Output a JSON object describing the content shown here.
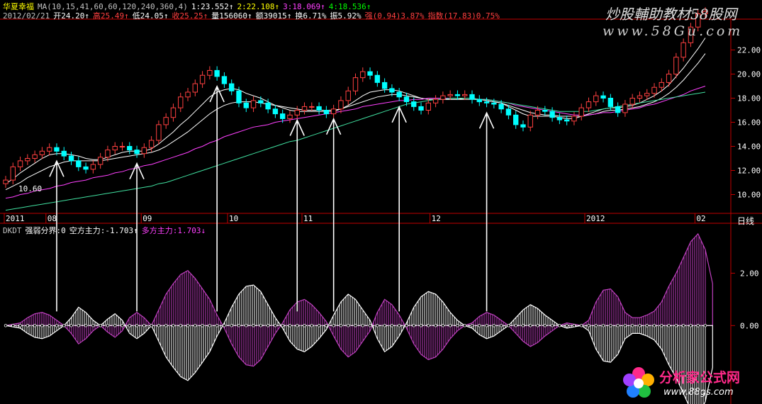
{
  "stock": {
    "name": "华夏幸福"
  },
  "ma_header": {
    "label": "MA(10,15,41,60,60,120,240,360,4)",
    "items": [
      {
        "label": "1:23.552↑",
        "color": "#ffffff"
      },
      {
        "label": "2:22.108↑",
        "color": "#ffff00"
      },
      {
        "label": "3:18.069↑",
        "color": "#ff40ff"
      },
      {
        "label": "4:18.536↑",
        "color": "#00ff00"
      }
    ]
  },
  "quote": {
    "date": "2012/02/21",
    "items": [
      {
        "label": "开24.20↑",
        "color": "#ffffff"
      },
      {
        "label": "高25.49↑",
        "color": "#ff4040"
      },
      {
        "label": "低24.05↑",
        "color": "#ffffff"
      },
      {
        "label": "收25.25↑",
        "color": "#ff4040"
      },
      {
        "label": "量156060↑",
        "color": "#ffffff"
      },
      {
        "label": "额39015↑",
        "color": "#ffffff"
      },
      {
        "label": "换6.71%",
        "color": "#ffffff"
      },
      {
        "label": "振5.92%",
        "color": "#ffffff"
      },
      {
        "label": "强(0.94)3.87%",
        "color": "#ff4040"
      },
      {
        "label": "指数(17.83)0.75%",
        "color": "#ff4040"
      }
    ]
  },
  "indicator_header": {
    "name": "DKDT",
    "items": [
      {
        "label": "强弱分界:0",
        "color": "#ffffff"
      },
      {
        "label": "空方主力:-1.703↑",
        "color": "#ffffff"
      },
      {
        "label": "多方主力:1.703↓",
        "color": "#ff40ff"
      }
    ]
  },
  "watermark": {
    "top_text": "炒股輔助教材58股网",
    "top_url": "www.58Gu.com",
    "bottom_text": "分析家公式网",
    "bottom_url": "www.88gs.com"
  },
  "annotations": {
    "low_price_label": "10.60"
  },
  "period_label": "日线",
  "colors": {
    "up": "#ff4040",
    "down": "#00ffff",
    "ma_fast": "#ffffff",
    "ma_mid": "#ff40ff",
    "ma_slow": "#40e0a0",
    "axis": "#c00000",
    "bull": "#c040c0",
    "bear": "#ffffff"
  },
  "chart_data": [
    {
      "type": "candlestick",
      "title": "",
      "y_ticks": [
        10.0,
        12.0,
        14.0,
        16.0,
        18.0,
        20.0,
        22.0
      ],
      "y_tick_labels": [
        "10.00",
        "12.00",
        "14.00",
        "16.00",
        "18.00",
        "20.00",
        "22.00"
      ],
      "ylim": [
        8.5,
        24.5
      ],
      "x_labels": [
        "2011",
        "08",
        "09",
        "10",
        "11",
        "12",
        "2012",
        "02"
      ],
      "close": [
        11.2,
        12.3,
        12.8,
        13.0,
        13.3,
        13.6,
        13.9,
        13.6,
        13.2,
        12.8,
        12.3,
        12.1,
        12.5,
        13.1,
        13.7,
        14.0,
        14.0,
        13.7,
        13.4,
        13.9,
        14.5,
        15.8,
        16.4,
        17.2,
        18.1,
        18.5,
        19.2,
        19.9,
        20.3,
        19.8,
        19.2,
        18.6,
        17.6,
        17.2,
        17.8,
        17.6,
        17.1,
        16.7,
        16.3,
        16.6,
        17.0,
        17.3,
        17.3,
        17.0,
        16.7,
        17.1,
        17.8,
        18.6,
        19.7,
        20.2,
        19.9,
        19.3,
        18.8,
        18.5,
        18.1,
        17.7,
        17.3,
        17.0,
        17.6,
        17.9,
        18.2,
        18.3,
        18.2,
        18.3,
        17.9,
        17.7,
        17.6,
        17.5,
        17.1,
        16.6,
        15.8,
        15.6,
        16.6,
        17.0,
        16.9,
        16.4,
        16.2,
        16.1,
        16.5,
        17.2,
        17.7,
        18.2,
        18.0,
        17.3,
        16.8,
        17.5,
        18.0,
        18.2,
        18.4,
        18.9,
        19.3,
        20.0,
        21.4,
        22.6,
        23.9,
        25.0,
        25.2
      ],
      "series": [
        {
          "name": "",
          "values": [
            10.9,
            11.3,
            11.8,
            12.2,
            12.6,
            13.0,
            13.3,
            13.4,
            13.4,
            13.3,
            13.2,
            13.0,
            12.9,
            12.9,
            13.1,
            13.3,
            13.5,
            13.6,
            13.6,
            13.6,
            13.8,
            14.2,
            14.7,
            15.2,
            15.8,
            16.3,
            16.9,
            17.5,
            18.1,
            18.5,
            18.7,
            18.8,
            18.7,
            18.4,
            18.2,
            18.0,
            17.7,
            17.4,
            17.2,
            17.0,
            16.9,
            16.9,
            16.9,
            16.9,
            16.9,
            16.9,
            17.1,
            17.4,
            17.8,
            18.2,
            18.5,
            18.6,
            18.7,
            18.7,
            18.6,
            18.4,
            18.2,
            18.0,
            17.9,
            17.9,
            17.9,
            17.9,
            17.9,
            18.0,
            18.0,
            17.9,
            17.8,
            17.7,
            17.6,
            17.3,
            17.0,
            16.7,
            16.5,
            16.5,
            16.5,
            16.5,
            16.4,
            16.3,
            16.3,
            16.5,
            16.7,
            16.9,
            17.1,
            17.2,
            17.2,
            17.3,
            17.4,
            17.6,
            17.9,
            18.2,
            18.6,
            19.1,
            19.8,
            20.5,
            21.3,
            22.1,
            23.0
          ]
        },
        {
          "name": "",
          "values": [
            10.4,
            10.7,
            11.0,
            11.4,
            11.7,
            12.0,
            12.3,
            12.5,
            12.7,
            12.8,
            12.8,
            12.8,
            12.8,
            12.8,
            12.9,
            13.0,
            13.1,
            13.2,
            13.3,
            13.4,
            13.5,
            13.7,
            14.0,
            14.4,
            14.8,
            15.2,
            15.7,
            16.2,
            16.7,
            17.1,
            17.4,
            17.6,
            17.7,
            17.7,
            17.7,
            17.6,
            17.5,
            17.4,
            17.3,
            17.2,
            17.1,
            17.0,
            17.0,
            17.0,
            17.0,
            17.0,
            17.1,
            17.3,
            17.5,
            17.7,
            17.9,
            18.1,
            18.2,
            18.3,
            18.3,
            18.2,
            18.1,
            18.0,
            17.9,
            17.9,
            17.9,
            17.9,
            17.9,
            17.9,
            17.9,
            17.9,
            17.8,
            17.7,
            17.6,
            17.4,
            17.2,
            17.0,
            16.8,
            16.7,
            16.6,
            16.6,
            16.5,
            16.5,
            16.5,
            16.5,
            16.6,
            16.7,
            16.9,
            17.0,
            17.0,
            17.1,
            17.2,
            17.3,
            17.5,
            17.7,
            18.0,
            18.4,
            18.9,
            19.5,
            20.2,
            20.9,
            21.7
          ]
        },
        {
          "name": "",
          "values": [
            9.7,
            9.8,
            10.0,
            10.1,
            10.3,
            10.4,
            10.5,
            10.7,
            10.8,
            11.0,
            11.1,
            11.2,
            11.4,
            11.5,
            11.6,
            11.8,
            11.9,
            12.1,
            12.2,
            12.4,
            12.5,
            12.7,
            12.9,
            13.1,
            13.3,
            13.5,
            13.8,
            14.0,
            14.3,
            14.5,
            14.8,
            15.0,
            15.2,
            15.4,
            15.6,
            15.7,
            15.8,
            16.0,
            16.1,
            16.2,
            16.3,
            16.4,
            16.5,
            16.6,
            16.7,
            16.8,
            16.9,
            17.0,
            17.1,
            17.3,
            17.4,
            17.5,
            17.6,
            17.7,
            17.8,
            17.8,
            17.9,
            17.9,
            18.0,
            18.0,
            18.0,
            18.0,
            18.0,
            18.0,
            18.0,
            17.9,
            17.9,
            17.8,
            17.7,
            17.6,
            17.4,
            17.3,
            17.2,
            17.1,
            17.0,
            16.9,
            16.8,
            16.7,
            16.6,
            16.6,
            16.6,
            16.7,
            16.8,
            16.8,
            16.9,
            17.0,
            17.1,
            17.2,
            17.4,
            17.5,
            17.7,
            17.9,
            18.1,
            18.3,
            18.6,
            18.8,
            19.0
          ]
        },
        {
          "name": "",
          "values": [
            8.7,
            8.8,
            8.9,
            9.0,
            9.1,
            9.2,
            9.3,
            9.4,
            9.5,
            9.6,
            9.7,
            9.8,
            9.9,
            10.0,
            10.1,
            10.2,
            10.3,
            10.4,
            10.5,
            10.6,
            10.7,
            10.9,
            11.0,
            11.2,
            11.4,
            11.6,
            11.8,
            12.0,
            12.2,
            12.4,
            12.6,
            12.8,
            13.0,
            13.2,
            13.4,
            13.6,
            13.8,
            14.0,
            14.2,
            14.4,
            14.5,
            14.7,
            14.9,
            15.1,
            15.3,
            15.5,
            15.7,
            15.9,
            16.1,
            16.3,
            16.5,
            16.7,
            16.9,
            17.1,
            17.3,
            17.5,
            17.6,
            17.7,
            17.8,
            17.9,
            17.9,
            18.0,
            18.0,
            18.0,
            18.0,
            17.9,
            17.9,
            17.8,
            17.7,
            17.6,
            17.5,
            17.4,
            17.3,
            17.2,
            17.1,
            17.0,
            16.9,
            16.9,
            16.9,
            16.9,
            16.9,
            17.0,
            17.1,
            17.2,
            17.3,
            17.4,
            17.5,
            17.6,
            17.7,
            17.8,
            17.9,
            18.0,
            18.1,
            18.2,
            18.3,
            18.4,
            18.5
          ]
        }
      ]
    },
    {
      "type": "area",
      "title": "DKDT",
      "y_ticks": [
        0.0,
        2.0
      ],
      "y_tick_labels": [
        "0.00",
        "2.00"
      ],
      "ylim": [
        -2.4,
        3.5
      ],
      "series": [
        {
          "name": "多方主力",
          "values": [
            0.0,
            0.05,
            0.1,
            0.3,
            0.45,
            0.5,
            0.4,
            0.2,
            0.0,
            -0.3,
            -0.7,
            -0.5,
            -0.2,
            0.0,
            -0.25,
            -0.45,
            -0.2,
            0.3,
            0.5,
            0.3,
            0.0,
            0.6,
            1.2,
            1.6,
            1.95,
            2.1,
            1.8,
            1.4,
            1.0,
            0.4,
            -0.1,
            -0.7,
            -1.2,
            -1.5,
            -1.55,
            -1.3,
            -0.8,
            -0.3,
            0.1,
            0.6,
            0.9,
            1.0,
            0.8,
            0.5,
            0.15,
            -0.4,
            -0.9,
            -1.2,
            -1.0,
            -0.6,
            -0.2,
            0.5,
            1.0,
            0.8,
            0.4,
            -0.1,
            -0.7,
            -1.1,
            -1.3,
            -1.2,
            -0.9,
            -0.5,
            -0.2,
            0.0,
            0.1,
            0.35,
            0.5,
            0.4,
            0.2,
            0.0,
            -0.3,
            -0.6,
            -0.8,
            -0.65,
            -0.4,
            -0.2,
            0.0,
            0.1,
            0.05,
            0.0,
            0.2,
            0.9,
            1.35,
            1.4,
            1.1,
            0.5,
            0.3,
            0.3,
            0.4,
            0.55,
            0.9,
            1.5,
            2.0,
            2.6,
            3.2,
            3.5,
            2.9,
            1.6
          ]
        },
        {
          "name": "空方主力",
          "values": [
            0.0,
            -0.05,
            -0.1,
            -0.3,
            -0.45,
            -0.5,
            -0.4,
            -0.2,
            0.0,
            0.3,
            0.7,
            0.5,
            0.2,
            0.0,
            0.25,
            0.45,
            0.2,
            -0.3,
            -0.5,
            -0.3,
            0.0,
            -0.6,
            -1.2,
            -1.6,
            -1.95,
            -2.1,
            -1.8,
            -1.4,
            -1.0,
            -0.4,
            0.1,
            0.7,
            1.2,
            1.5,
            1.55,
            1.3,
            0.8,
            0.3,
            -0.1,
            -0.6,
            -0.9,
            -1.0,
            -0.8,
            -0.5,
            -0.15,
            0.4,
            0.9,
            1.2,
            1.0,
            0.6,
            0.2,
            -0.5,
            -1.0,
            -0.8,
            -0.4,
            0.1,
            0.7,
            1.1,
            1.3,
            1.2,
            0.9,
            0.5,
            0.2,
            0.0,
            -0.1,
            -0.35,
            -0.5,
            -0.4,
            -0.2,
            0.0,
            0.3,
            0.6,
            0.8,
            0.65,
            0.4,
            0.2,
            0.0,
            -0.1,
            -0.05,
            0.0,
            -0.2,
            -0.9,
            -1.35,
            -1.4,
            -1.1,
            -0.5,
            -0.3,
            -0.3,
            -0.4,
            -0.55,
            -0.9,
            -1.5,
            -2.0,
            -2.6,
            -3.2,
            -3.5,
            -2.9,
            -1.6
          ]
        }
      ]
    }
  ],
  "arrow_bars": [
    7,
    18,
    29,
    40,
    45,
    54,
    66
  ]
}
